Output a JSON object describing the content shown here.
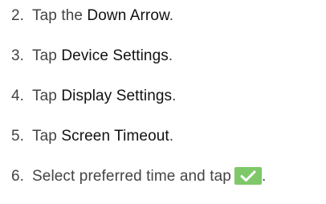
{
  "steps": [
    {
      "number": "2.",
      "prefix": "Tap the ",
      "emphasis": "Down Arrow",
      "suffix": "."
    },
    {
      "number": "3.",
      "prefix": "Tap ",
      "emphasis": "Device Settings",
      "suffix": "."
    },
    {
      "number": "4.",
      "prefix": "Tap ",
      "emphasis": "Display Settings",
      "suffix": "."
    },
    {
      "number": "5.",
      "prefix": "Tap ",
      "emphasis": "Screen Timeout",
      "suffix": "."
    },
    {
      "number": "6.",
      "prefix": "Select preferred time and tap",
      "suffix": "."
    }
  ],
  "icons": {
    "confirm": "checkmark-icon",
    "confirm_color": "#7fc86a"
  }
}
